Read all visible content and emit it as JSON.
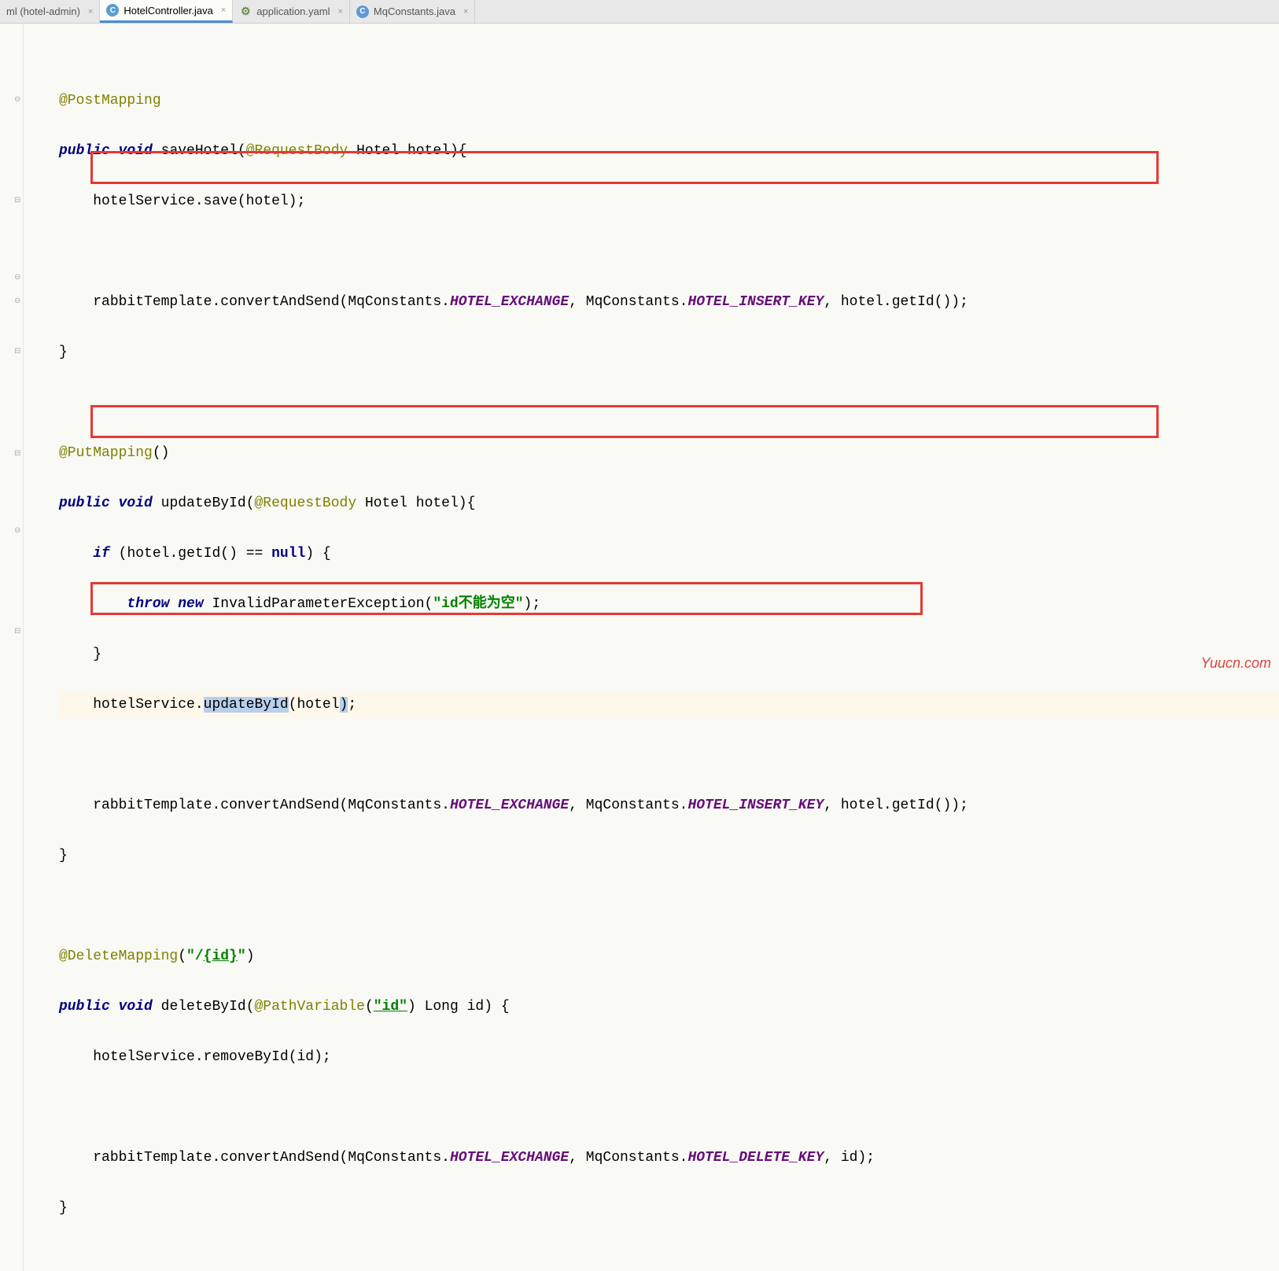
{
  "tabs": [
    {
      "label": "ml (hotel-admin)",
      "icon": "",
      "active": false
    },
    {
      "label": "HotelController.java",
      "icon": "C",
      "active": true
    },
    {
      "label": "application.yaml",
      "icon": "⚙",
      "active": false
    },
    {
      "label": "MqConstants.java",
      "icon": "C",
      "active": false
    }
  ],
  "close_glyph": "×",
  "code": {
    "post_mapping": "@PostMapping",
    "put_mapping": "@PutMapping",
    "delete_mapping": "@DeleteMapping",
    "request_body": "@RequestBody",
    "path_variable": "@PathVariable",
    "kw_public": "public",
    "kw_void": "void",
    "kw_if": "if",
    "kw_throw": "throw",
    "kw_new": "new",
    "kw_null": "null",
    "m_saveHotel": "saveHotel",
    "m_updateById": "updateById",
    "m_deleteById": "deleteById",
    "t_Hotel": "Hotel",
    "t_Long": "Long",
    "t_InvalidParameterException": "InvalidParameterException",
    "p_hotel": "hotel",
    "p_id": "id",
    "hotelService": "hotelService",
    "rabbitTemplate": "rabbitTemplate",
    "save": "save",
    "removeById": "removeById",
    "getId": "getId",
    "convertAndSend": "convertAndSend",
    "mqc": "MqConstants",
    "ex": "HOTEL_EXCHANGE",
    "ins_key": "HOTEL_INSERT_KEY",
    "del_key": "HOTEL_DELETE_KEY",
    "str_id": "\"id\"",
    "str_path": "\"/{id}\"",
    "str_err": "\"id不能为空\"",
    "eq": " == ",
    "updateByIdCall": "updateById"
  },
  "watermark": "Yuucn.com"
}
